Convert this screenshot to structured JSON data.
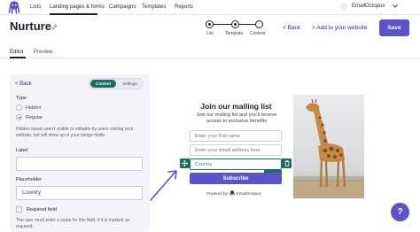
{
  "nav": {
    "items": [
      {
        "label": "Lists"
      },
      {
        "label": "Landing pages & forms"
      },
      {
        "label": "Campaigns"
      },
      {
        "label": "Templates"
      },
      {
        "label": "Reports"
      }
    ],
    "active_item": "Landing pages & forms",
    "account_name": "EmailOctopus"
  },
  "header": {
    "title": "Nurture",
    "steps": [
      {
        "label": "List",
        "state": "done"
      },
      {
        "label": "Template",
        "state": "done"
      },
      {
        "label": "Content",
        "state": "current"
      }
    ],
    "back_label": "< Back",
    "next_label": "> Add to your website",
    "save_label": "Save"
  },
  "tabs": [
    {
      "label": "Editor",
      "active": true
    },
    {
      "label": "Preview",
      "active": false
    }
  ],
  "editor": {
    "back_label": "< Back",
    "segment": {
      "content_label": "Content",
      "settings_label": "Settings",
      "active": "Content"
    },
    "type_label": "Type",
    "type_options": [
      {
        "label": "Hidden",
        "checked": false
      },
      {
        "label": "Regular",
        "checked": true
      }
    ],
    "hidden_help": "Hidden inputs aren't visible or editable by users visiting your website, but will show up in your merge fields.",
    "label_label": "Label",
    "label_value": "",
    "placeholder_label": "Placeholder",
    "placeholder_value": "Country",
    "required_label": "Required field",
    "required_checked": false,
    "required_help": "The user must enter a value for this field, if it is marked as required."
  },
  "form_preview": {
    "title": "Join our mailing list",
    "subtitle": "Join our mailing list and you'll receive access to exclusive benefits",
    "fields": [
      {
        "placeholder": "Enter your first name"
      },
      {
        "placeholder": "Enter your email address here"
      },
      {
        "placeholder": "Country",
        "selected": true
      }
    ],
    "selected_tag": "Country",
    "subscribe_label": "Subscribe",
    "powered_by": "Powered by",
    "powered_brand": "EmailOctopus"
  },
  "help_button_label": "?",
  "colors": {
    "accent": "#5c52c9",
    "teal": "#1d6b62",
    "link": "#2a2a9a",
    "text": "#1c1f33"
  }
}
